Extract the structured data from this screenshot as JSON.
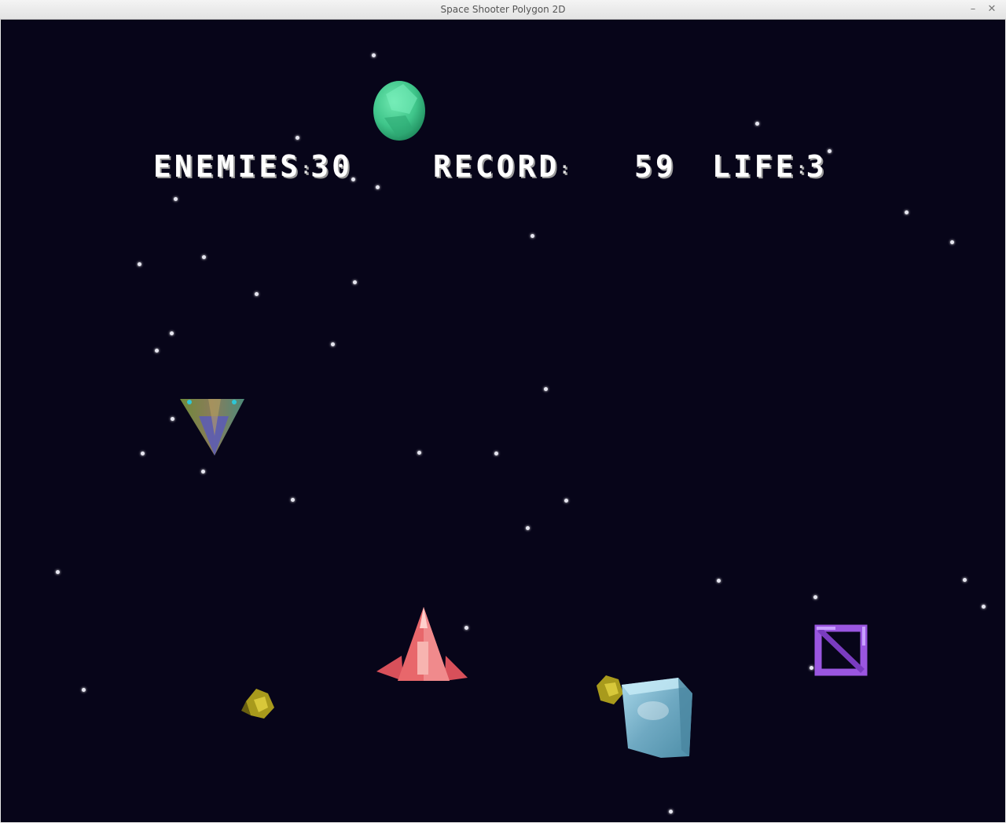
{
  "window": {
    "title": "Space Shooter Polygon 2D",
    "minimize_glyph": "–",
    "close_glyph": "✕"
  },
  "hud": {
    "enemies_label": "ENEMIES",
    "enemies_value": "30",
    "record_label": "RECORD",
    "record_value": "59",
    "life_label": "LIFE",
    "life_value": "3",
    "separator": ":"
  },
  "colors": {
    "space_background": "#070519",
    "player_ship": "#e8676b",
    "asteroid_green": "#3fc58a",
    "ice_cube": "#7fb6cc",
    "purple_frame": "#9a56e0",
    "yellow_debris": "#a89a1c"
  },
  "sprites": {
    "player": "red-rocket-ship",
    "enemy_ship": "triangle-fighter",
    "asteroid": "green-polyhedron",
    "cube": "ice-cube-block",
    "frame": "purple-wire-frame",
    "debris": "yellow-debris"
  }
}
